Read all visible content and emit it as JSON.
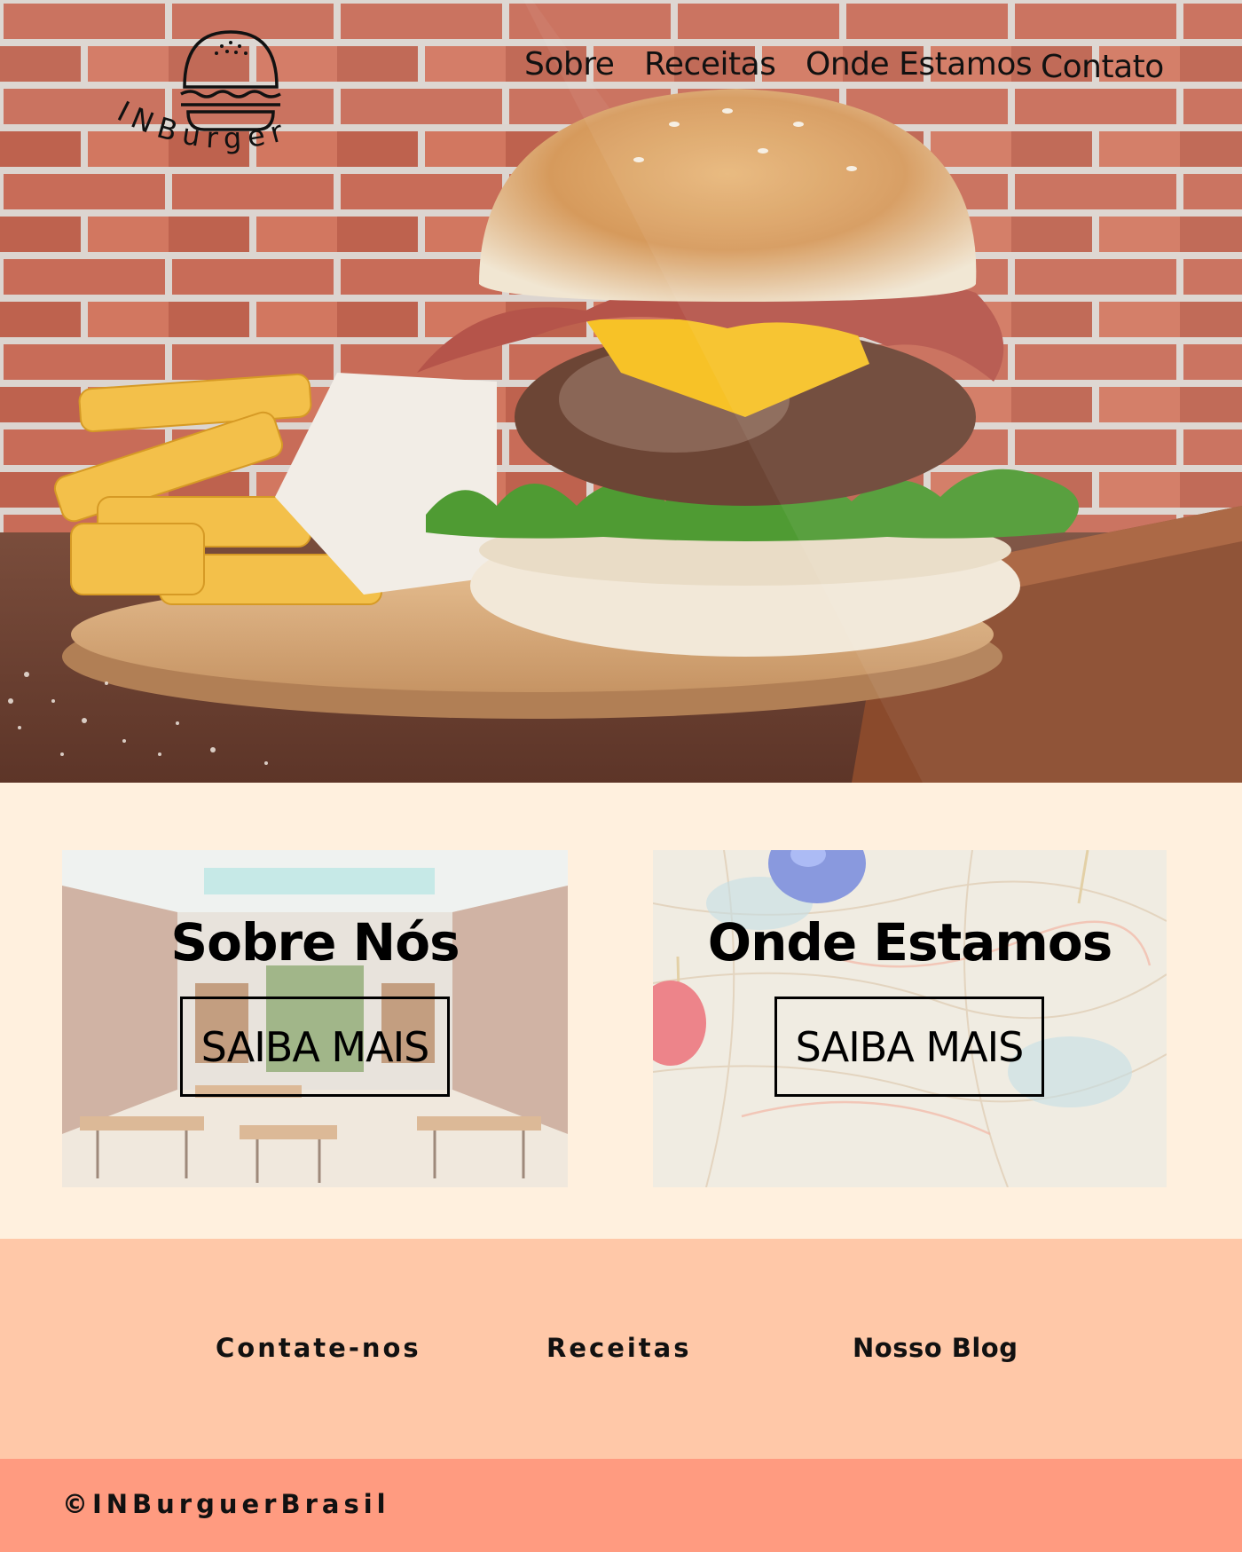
{
  "brand": {
    "logo_text": "INBurger"
  },
  "nav": {
    "items": [
      {
        "label": "Sobre"
      },
      {
        "label": "Receitas"
      },
      {
        "label": "Onde Estamos"
      },
      {
        "label": "Contato"
      }
    ]
  },
  "cards": [
    {
      "title": "Sobre Nós",
      "button": "SAIBA MAIS",
      "image": "restaurant-interior"
    },
    {
      "title": "Onde Estamos",
      "button": "SAIBA MAIS",
      "image": "map-with-pins"
    }
  ],
  "footer": {
    "links": [
      {
        "label": "Contate-nos"
      },
      {
        "label": "Receitas"
      },
      {
        "label": "Nosso Blog"
      }
    ],
    "copyright": "©INBurguerBrasil"
  },
  "colors": {
    "page_bg": "#fff0de",
    "footer_links_bg": "#ffc8a8",
    "copyright_bg": "#ff9b80",
    "text": "#111111"
  }
}
